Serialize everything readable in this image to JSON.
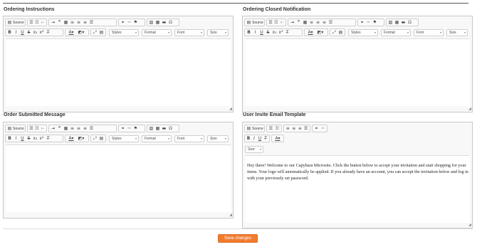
{
  "sections": {
    "ordering_instructions": {
      "label": "Ordering Instructions"
    },
    "ordering_closed": {
      "label": "Ordering Closed Notification"
    },
    "order_submitted": {
      "label": "Order Submitted Message"
    },
    "user_invite": {
      "label": "User Invite Email Template",
      "content": "Hey there! Welcome to our Capybara Microsite. Click the button below to accept your invitation and start shopping for your items. Your logo will automatically be applied.  If you already have an account, you can accept the invitation below and log in with your previously set password."
    }
  },
  "toolbar": {
    "source_label": "Source",
    "styles_label": "Styles",
    "format_label": "Format",
    "font_label": "Font",
    "size_label": "Size",
    "icons": [
      "source-icon",
      "numbered-list-icon",
      "bulleted-list-icon",
      "outdent-icon",
      "indent-icon",
      "blockquote-icon",
      "div-icon",
      "align-left-icon",
      "align-center-icon",
      "align-right-icon",
      "justify-icon",
      "link-icon",
      "unlink-icon",
      "anchor-icon",
      "image-icon",
      "table-icon",
      "horizontal-line-icon",
      "special-char-icon",
      "bold-icon",
      "italic-icon",
      "underline-icon",
      "strike-icon",
      "subscript-icon",
      "superscript-icon",
      "remove-format-icon",
      "text-color-icon",
      "bg-color-icon",
      "maximize-icon",
      "show-blocks-icon"
    ]
  },
  "actions": {
    "save_label": "Save changes"
  },
  "colors": {
    "accent": "#f07c30",
    "editor_bg": "#f8f8f8",
    "border": "#c8c8c8"
  }
}
